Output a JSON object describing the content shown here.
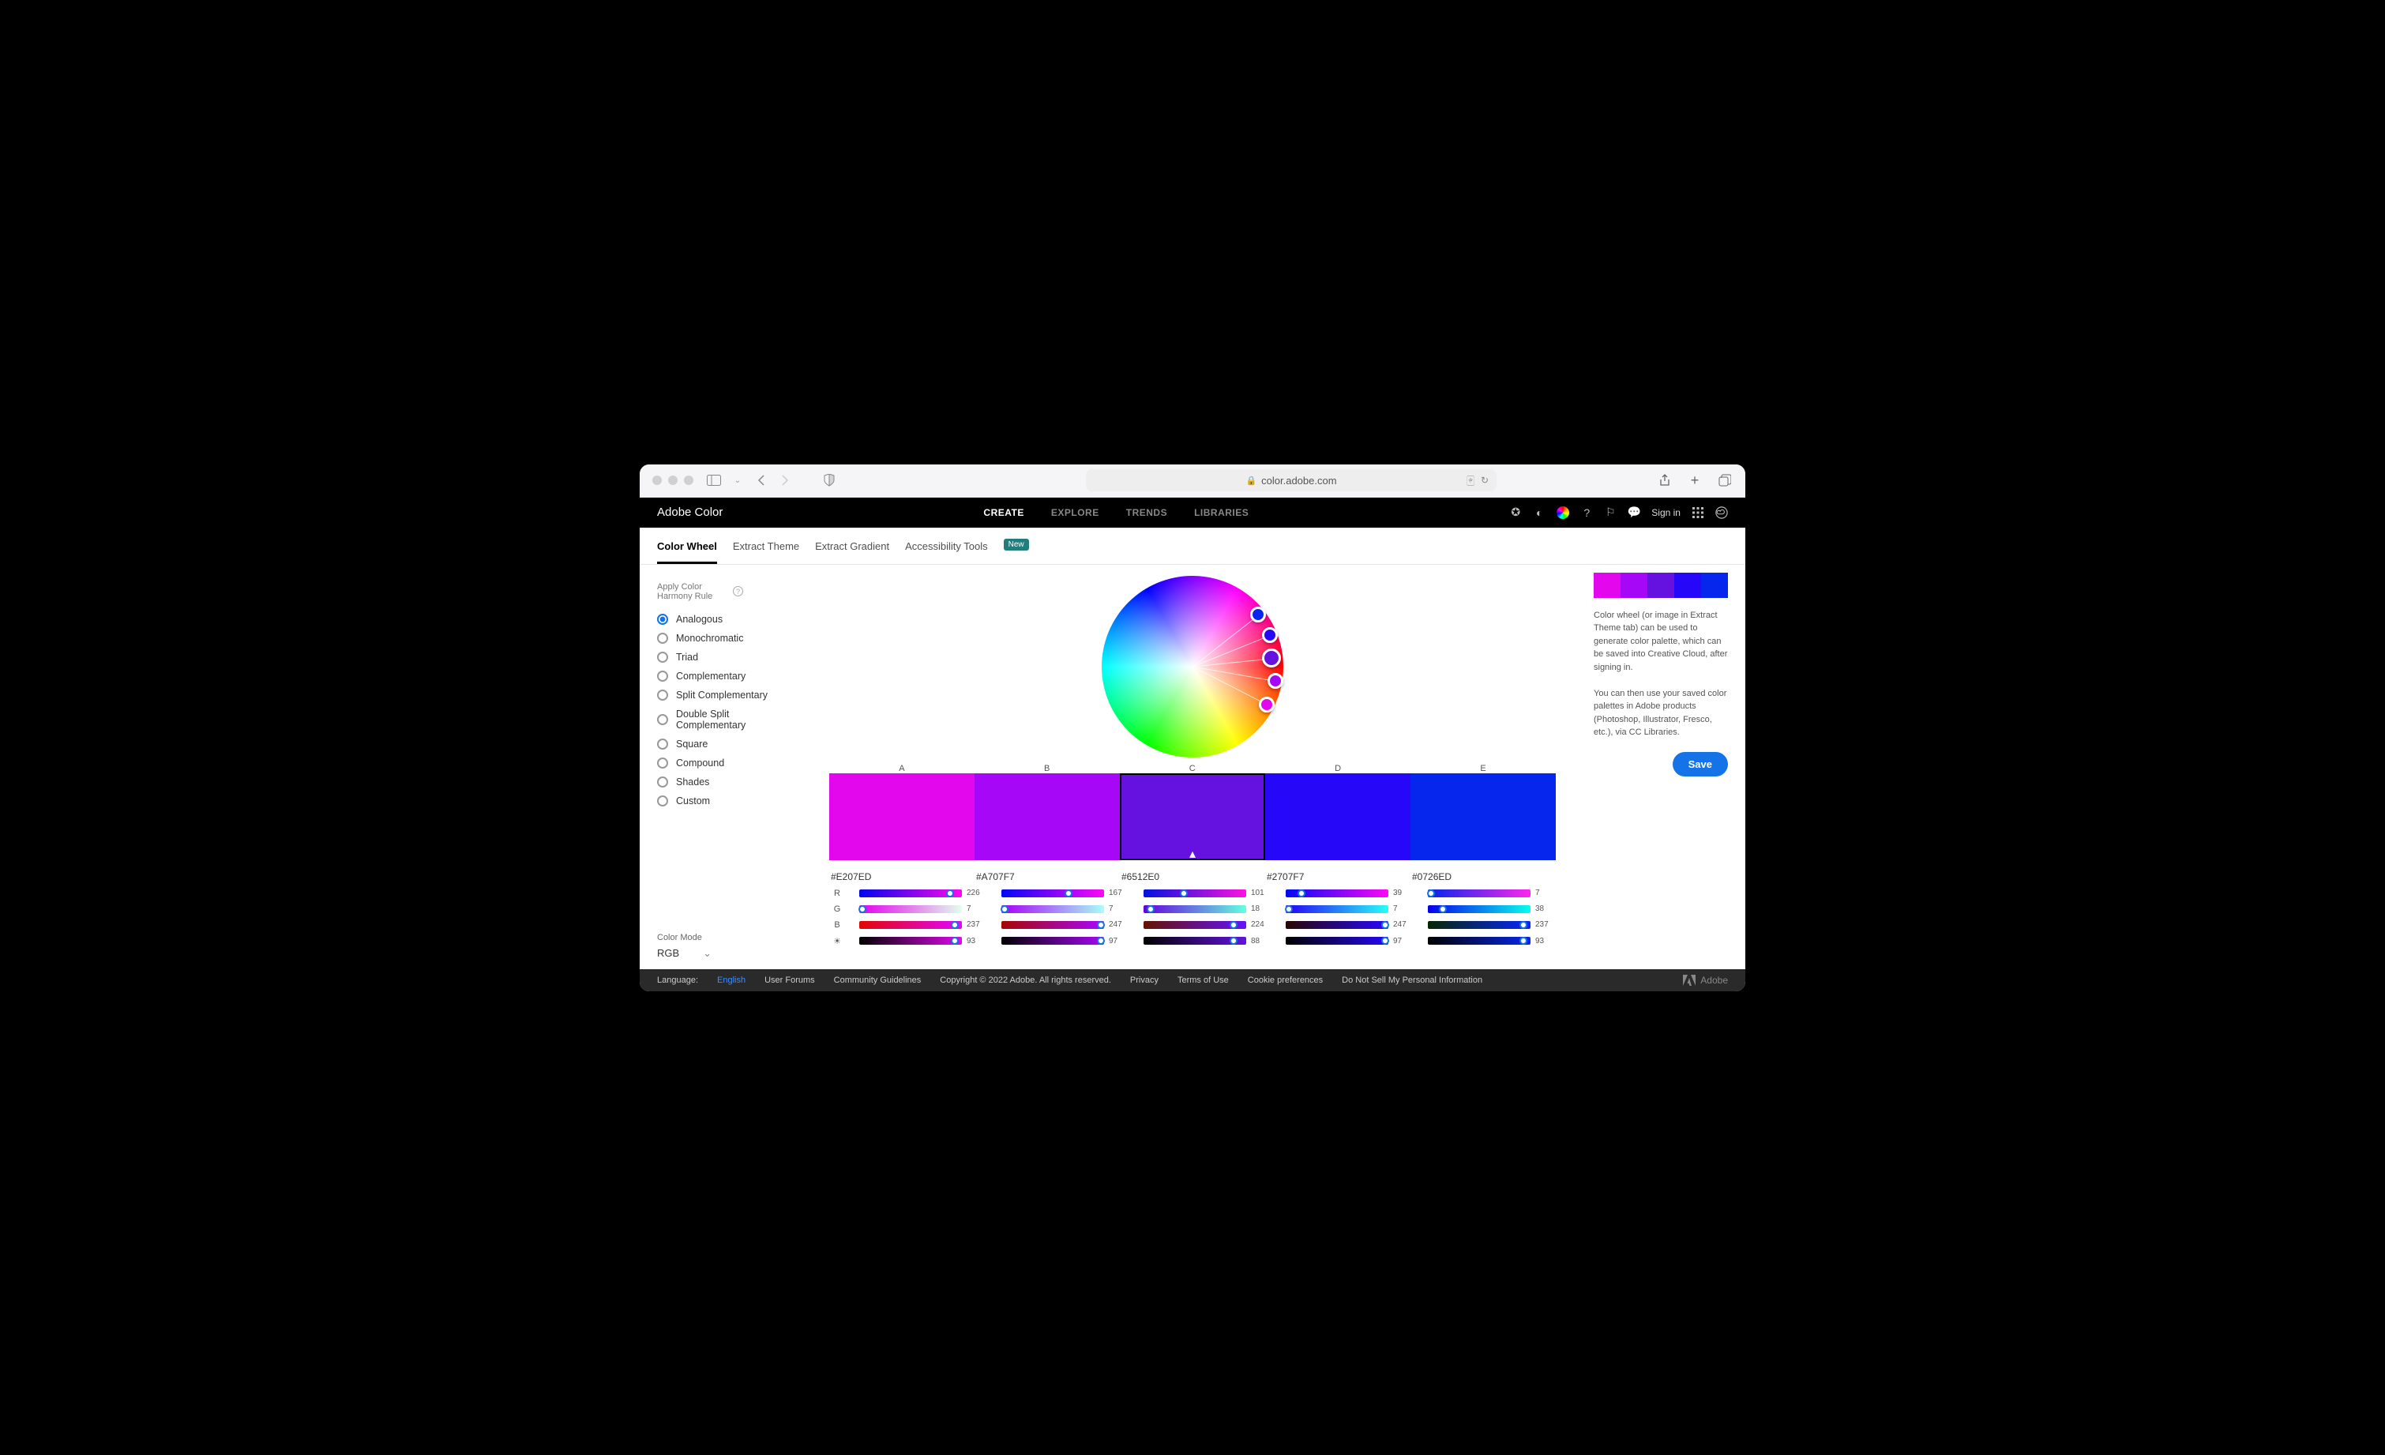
{
  "browser": {
    "url": "color.adobe.com"
  },
  "header": {
    "title": "Adobe Color",
    "nav": [
      "CREATE",
      "EXPLORE",
      "TRENDS",
      "LIBRARIES"
    ],
    "active_nav": 0,
    "signin": "Sign in"
  },
  "subnav": {
    "tabs": [
      "Color Wheel",
      "Extract Theme",
      "Extract Gradient",
      "Accessibility Tools"
    ],
    "active": 0,
    "badge": "New"
  },
  "harmony": {
    "label": "Apply Color Harmony Rule",
    "options": [
      "Analogous",
      "Monochromatic",
      "Triad",
      "Complementary",
      "Split Complementary",
      "Double Split Complementary",
      "Square",
      "Compound",
      "Shades",
      "Custom"
    ],
    "selected": 0
  },
  "color_mode": {
    "label": "Color Mode",
    "value": "RGB"
  },
  "swatch_labels": [
    "A",
    "B",
    "C",
    "D",
    "E"
  ],
  "colors": [
    {
      "hex": "#E207ED",
      "r": 226,
      "g": 7,
      "b": 237,
      "l": 93
    },
    {
      "hex": "#A707F7",
      "r": 167,
      "g": 7,
      "b": 247,
      "l": 97
    },
    {
      "hex": "#6512E0",
      "r": 101,
      "g": 18,
      "b": 224,
      "l": 88,
      "selected": true
    },
    {
      "hex": "#2707F7",
      "r": 39,
      "g": 7,
      "b": 247,
      "l": 97
    },
    {
      "hex": "#0726ED",
      "r": 7,
      "g": 38,
      "b": 237,
      "l": 93
    }
  ],
  "slider_labels": {
    "r": "R",
    "g": "G",
    "b": "B"
  },
  "info": {
    "p1": "Color wheel (or image in Extract Theme tab) can be used to generate color palette, which can be saved into Creative Cloud, after signing in.",
    "p2": "You can then use your saved color palettes in Adobe products (Photoshop, Illustrator, Fresco, etc.), via CC Libraries.",
    "save": "Save"
  },
  "footer": {
    "language_label": "Language:",
    "language": "English",
    "links": [
      "User Forums",
      "Community Guidelines",
      "Copyright © 2022 Adobe. All rights reserved.",
      "Privacy",
      "Terms of Use",
      "Cookie preferences",
      "Do Not Sell My Personal Information"
    ],
    "brand": "Adobe"
  }
}
